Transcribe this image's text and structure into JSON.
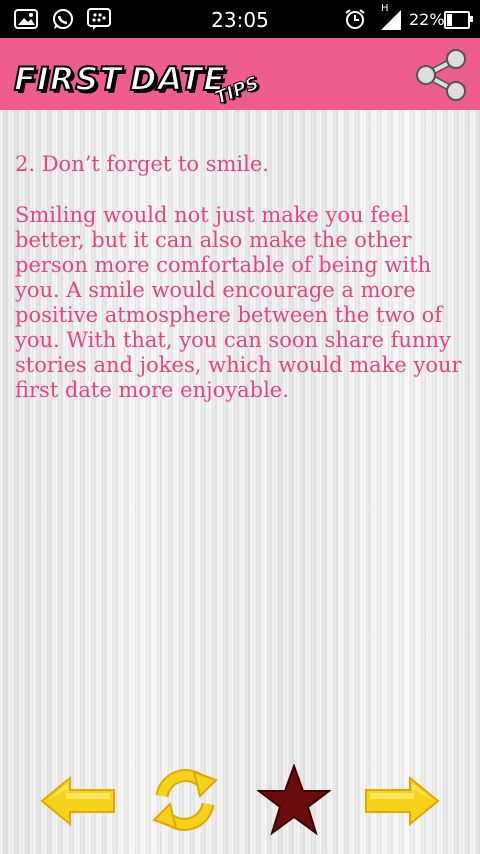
{
  "status_bar": {
    "time": "23:05",
    "network": "H",
    "battery": "22%",
    "icons": [
      "gallery-icon",
      "whatsapp-icon",
      "bbm-icon",
      "alarm-icon",
      "signal-icon",
      "battery-icon"
    ]
  },
  "app_bar": {
    "title_word1": "FIRST",
    "title_word2": "DATE",
    "title_tag": "TIPS",
    "share_icon": "share-icon",
    "color": "#ef5d8e"
  },
  "tip": {
    "title": "2. Don’t forget to smile.",
    "body": "Smiling would not just make you feel better, but it can also make the other person more comfortable of being with you. A smile would encourage a more positive atmosphere between the two of you. With that, you can soon share funny stories and jokes, which would make your first date more enjoyable.",
    "text_color": "#e4457f"
  },
  "bottom_bar": {
    "buttons": [
      "previous-arrow-icon",
      "refresh-icon",
      "favorite-star-icon",
      "next-arrow-icon"
    ],
    "arrow_color": "#f7d21a",
    "star_color": "#6b0d0d"
  }
}
